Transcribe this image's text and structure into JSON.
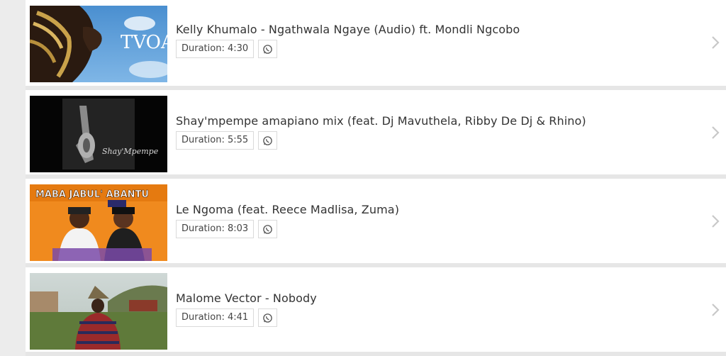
{
  "songs": [
    {
      "title": "Kelly Khumalo - Ngathwala Ngaye (Audio) ft. Mondli Ngcobo",
      "duration": "Duration: 4:30",
      "thumb_text": "TVOA"
    },
    {
      "title": "Shay'mpempe amapiano mix (feat. Dj Mavuthela, Ribby De Dj & Rhino)",
      "duration": "Duration: 5:55",
      "thumb_text": "Shay'Mpempe"
    },
    {
      "title": "Le Ngoma (feat. Reece Madlisa, Zuma)",
      "duration": "Duration: 8:03",
      "thumb_text": "MABA JABUL' ABANTU"
    },
    {
      "title": "Malome Vector - Nobody",
      "duration": "Duration: 4:41"
    }
  ],
  "icons": {
    "share": "whatsapp-icon",
    "open": "chevron-right-icon"
  },
  "colors": {
    "background": "#ececec",
    "card": "#ffffff",
    "text": "#333333",
    "chevron": "#c8c8c8"
  }
}
